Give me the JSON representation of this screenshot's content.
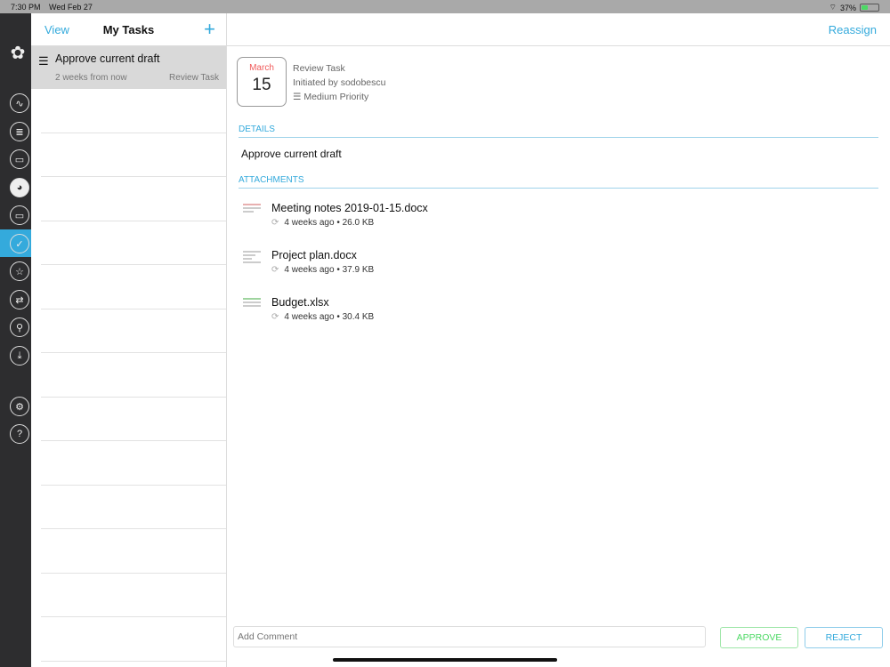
{
  "status": {
    "time": "7:30 PM",
    "date": "Wed Feb 27",
    "battery": "37%",
    "battery_level": 0.37
  },
  "sidebar": {
    "items": [
      "logo",
      "activity",
      "database",
      "shared-folder",
      "globe",
      "folder",
      "tasks",
      "favorites",
      "sync",
      "search",
      "downloads",
      "settings",
      "help"
    ],
    "active": "tasks"
  },
  "list": {
    "view": "View",
    "title": "My Tasks",
    "add": "+",
    "items": [
      {
        "name": "Approve current draft",
        "due": "2 weeks from now",
        "type": "Review Task"
      }
    ]
  },
  "detail": {
    "reassign": "Reassign",
    "month": "March",
    "day": "15",
    "task_type": "Review Task",
    "initiated": "Initiated by sodobescu",
    "priority": "Medium Priority",
    "details_header": "DETAILS",
    "details": "Approve current draft",
    "attachments_header": "ATTACHMENTS",
    "attachments": [
      {
        "name": "Meeting notes 2019-01-15.docx",
        "meta": "4 weeks ago • 26.0 KB"
      },
      {
        "name": "Project plan.docx",
        "meta": "4 weeks ago • 37.9 KB"
      },
      {
        "name": "Budget.xlsx",
        "meta": "4 weeks ago • 30.4 KB"
      }
    ],
    "comment_placeholder": "Add Comment",
    "approve": "APPROVE",
    "reject": "REJECT"
  },
  "colors": {
    "accent": "#34aadc",
    "approve": "#4cd964",
    "date": "#f05a5a"
  }
}
